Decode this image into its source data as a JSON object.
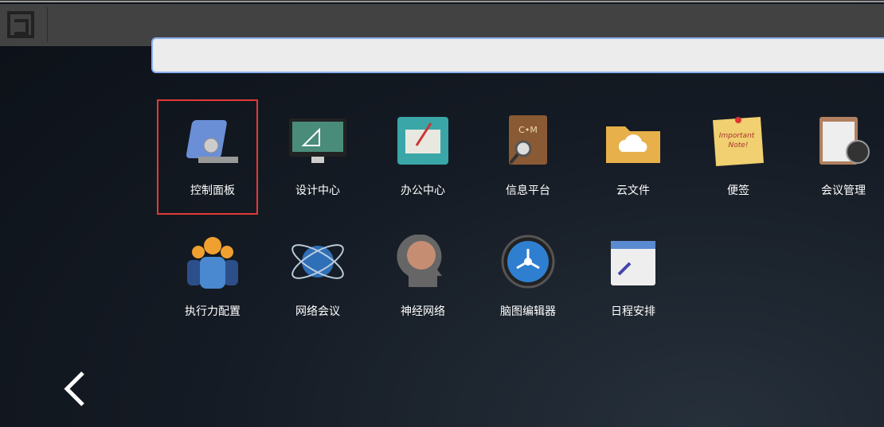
{
  "search": {
    "value": "",
    "placeholder": ""
  },
  "apps": [
    {
      "label": "控制面板",
      "icon": "control-panel-icon",
      "selected": true
    },
    {
      "label": "设计中心",
      "icon": "imac-design-icon"
    },
    {
      "label": "办公中心",
      "icon": "office-notebook-icon"
    },
    {
      "label": "信息平台",
      "icon": "cm-book-magnifier-icon"
    },
    {
      "label": "云文件",
      "icon": "cloud-folder-icon"
    },
    {
      "label": "便签",
      "icon": "sticky-note-icon",
      "note_text": "Important Note!"
    },
    {
      "label": "会议管理",
      "icon": "clipboard-clock-icon"
    },
    {
      "label": "执行力配置",
      "icon": "people-group-icon"
    },
    {
      "label": "网络会议",
      "icon": "globe-orbit-icon"
    },
    {
      "label": "神经网络",
      "icon": "brain-head-icon"
    },
    {
      "label": "脑图编辑器",
      "icon": "mindmap-node-icon"
    },
    {
      "label": "日程安排",
      "icon": "calendar-icon"
    }
  ],
  "colors": {
    "selection": "#e53935",
    "search_border": "#8ab0f0"
  }
}
